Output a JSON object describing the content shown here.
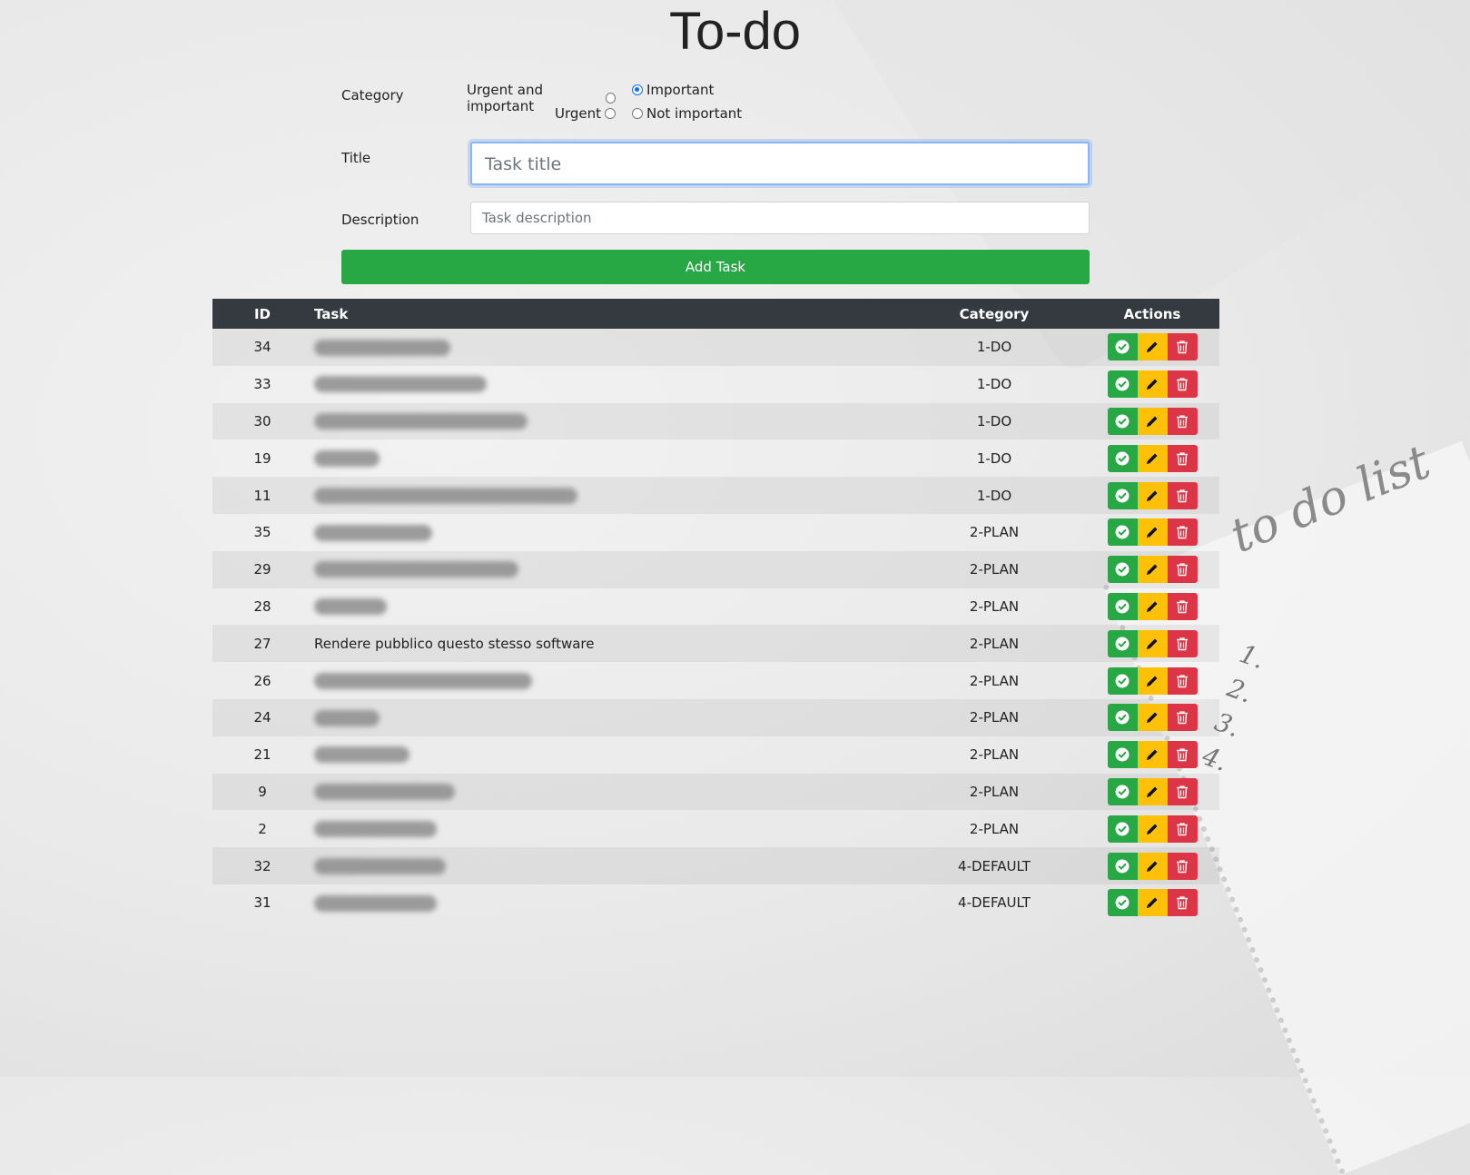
{
  "page": {
    "title": "To-do"
  },
  "form": {
    "category_label": "Category",
    "categories": [
      {
        "label": "Urgent and important",
        "checked": false
      },
      {
        "label": "Important",
        "checked": true
      },
      {
        "label": "Urgent",
        "checked": false
      },
      {
        "label": "Not important",
        "checked": false
      }
    ],
    "title_label": "Title",
    "title_placeholder": "Task title",
    "description_label": "Description",
    "description_placeholder": "Task description",
    "add_button_label": "Add Task"
  },
  "table": {
    "headers": {
      "id": "ID",
      "task": "Task",
      "category": "Category",
      "actions": "Actions"
    },
    "rows": [
      {
        "id": "34",
        "task": "",
        "task_redacted": true,
        "category": "1-DO"
      },
      {
        "id": "33",
        "task": "",
        "task_redacted": true,
        "category": "1-DO"
      },
      {
        "id": "30",
        "task": "",
        "task_redacted": true,
        "category": "1-DO"
      },
      {
        "id": "19",
        "task": "",
        "task_redacted": true,
        "category": "1-DO"
      },
      {
        "id": "11",
        "task": "",
        "task_redacted": true,
        "category": "1-DO"
      },
      {
        "id": "35",
        "task": "",
        "task_redacted": true,
        "category": "2-PLAN"
      },
      {
        "id": "29",
        "task": "",
        "task_redacted": true,
        "category": "2-PLAN"
      },
      {
        "id": "28",
        "task": "",
        "task_redacted": true,
        "category": "2-PLAN"
      },
      {
        "id": "27",
        "task": "Rendere pubblico questo stesso software",
        "task_redacted": false,
        "category": "2-PLAN"
      },
      {
        "id": "26",
        "task": "",
        "task_redacted": true,
        "category": "2-PLAN"
      },
      {
        "id": "24",
        "task": "",
        "task_redacted": true,
        "category": "2-PLAN"
      },
      {
        "id": "21",
        "task": "",
        "task_redacted": true,
        "category": "2-PLAN"
      },
      {
        "id": "9",
        "task": "",
        "task_redacted": true,
        "category": "2-PLAN"
      },
      {
        "id": "2",
        "task": "",
        "task_redacted": true,
        "category": "2-PLAN"
      },
      {
        "id": "32",
        "task": "",
        "task_redacted": true,
        "category": "4-DEFAULT"
      },
      {
        "id": "31",
        "task": "",
        "task_redacted": true,
        "category": "4-DEFAULT"
      }
    ],
    "actions": [
      {
        "name": "complete",
        "icon": "check-circle-icon",
        "color": "#28a745"
      },
      {
        "name": "edit",
        "icon": "pencil-icon",
        "color": "#ffc107"
      },
      {
        "name": "delete",
        "icon": "trash-icon",
        "color": "#dc3545"
      }
    ]
  },
  "colors": {
    "header_bg": "#343a40",
    "success": "#28a745",
    "warning": "#ffc107",
    "danger": "#dc3545",
    "focus": "#86b7fe"
  }
}
